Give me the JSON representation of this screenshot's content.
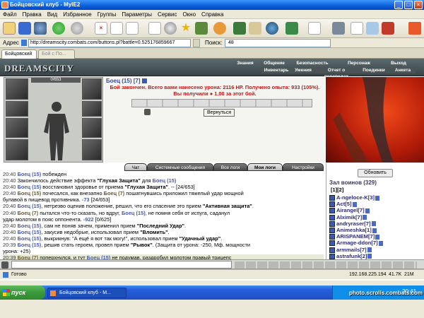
{
  "window": {
    "title": "Бойцовский клуб - MyIE2",
    "minimize": "_",
    "maximize": "□",
    "close": "×"
  },
  "menu": [
    "Файл",
    "Правка",
    "Вид",
    "Избранное",
    "Группы",
    "Параметры",
    "Сервис",
    "Окно",
    "Справка"
  ],
  "address": {
    "label": "Адрес",
    "url": "http://dreamscity.combats.com/buttons.pl?battle=0.525176859667",
    "search_label": "Поиск:",
    "search_value": "48"
  },
  "tabs": [
    "Бойцовский",
    "Бой с По..."
  ],
  "game": {
    "logo": "DREAMSCITY",
    "nav_top": [
      "Знания",
      "Общение",
      "Безопасность",
      "Персонаж",
      "Выход"
    ],
    "nav_bottom": [
      "Инвентарь",
      "Умения",
      "Отчет о переводах",
      "Поединки",
      "Анкета"
    ],
    "hp_readout": "0/653",
    "fighter": {
      "name": "Боец",
      "level": "(15)",
      "rank": "[7]"
    },
    "battle_result": "Бой закончен. Всего вами нанесено урона: 2116 HP. Получено опыта: 933 (105%). Вы получили",
    "battle_reward": "1.00 за этот бой.",
    "return_button": "Вернуться",
    "refresh_button": "Обновить",
    "hall_title": "Зал воинов (329)",
    "pages": [
      "[1]",
      "[2]"
    ]
  },
  "chat_tabs": [
    "Чат",
    "Системные сообщения",
    "Все логи",
    "Мои логи",
    "Настройки"
  ],
  "log": [
    {
      "time": "20:40",
      "parts": [
        {
          "c": "n",
          "t": "Боец (15)"
        },
        {
          "c": "",
          "t": " побежден"
        }
      ]
    },
    {
      "time": "20:40",
      "parts": [
        {
          "c": "",
          "t": "Закончилось действие эффекта "
        },
        {
          "c": "q",
          "t": "\"Глухая Защита\""
        },
        {
          "c": "",
          "t": " для "
        },
        {
          "c": "n",
          "t": "Боец (15)"
        }
      ]
    },
    {
      "time": "20:40",
      "parts": [
        {
          "c": "n",
          "t": "Боец (15)"
        },
        {
          "c": "",
          "t": " восстановил здоровье от приема "
        },
        {
          "c": "q",
          "t": "\"Глухая Защита\""
        },
        {
          "c": "",
          "t": ". -- [24/653]"
        }
      ]
    },
    {
      "time": "20:40",
      "parts": [
        {
          "c": "e",
          "t": "Боец (15)"
        },
        {
          "c": "",
          "t": " почесался, как внезапно "
        },
        {
          "c": "e",
          "t": "Боец (7)"
        },
        {
          "c": "",
          "t": " пошатнувшись приложил тяжелый удар мощной"
        }
      ]
    },
    {
      "time": "",
      "parts": [
        {
          "c": "",
          "t": "булавой в пищевод противника. "
        },
        {
          "c": "d",
          "t": "-73"
        },
        {
          "c": "",
          "t": " [24/653]"
        }
      ]
    },
    {
      "time": "20:40",
      "parts": [
        {
          "c": "n",
          "t": "Боец (15)"
        },
        {
          "c": "",
          "t": ", нетрезво оценив положение, решил, что его спасение это прием "
        },
        {
          "c": "q",
          "t": "\"Активная защита\""
        },
        {
          "c": "",
          "t": "."
        }
      ]
    },
    {
      "time": "20:40",
      "parts": [
        {
          "c": "e",
          "t": "Боец (7)"
        },
        {
          "c": "",
          "t": " пытался что-то сказать, но вдруг, "
        },
        {
          "c": "n",
          "t": "Боец (15)"
        },
        {
          "c": "",
          "t": ", не помня себя от испуга, саданул"
        }
      ]
    },
    {
      "time": "",
      "parts": [
        {
          "c": "",
          "t": "удар молотом в пояс оппонента. "
        },
        {
          "c": "d",
          "t": "-922"
        },
        {
          "c": "",
          "t": " [0/625]"
        }
      ]
    },
    {
      "time": "20:40",
      "parts": [
        {
          "c": "n",
          "t": "Боец (15)"
        },
        {
          "c": "",
          "t": ", сам не поняв зачем, применил прием "
        },
        {
          "c": "q",
          "t": "\"Последний Удар\""
        },
        {
          "c": "",
          "t": "."
        }
      ]
    },
    {
      "time": "20:40",
      "parts": [
        {
          "c": "n",
          "t": "Боец (15)"
        },
        {
          "c": "",
          "t": ", закусив недобрые, использовал прием "
        },
        {
          "c": "q",
          "t": "\"Вломить\""
        },
        {
          "c": "",
          "t": "."
        }
      ]
    },
    {
      "time": "20:40",
      "parts": [
        {
          "c": "n",
          "t": "Боец (15)"
        },
        {
          "c": "",
          "t": ", выкрикнув: \"А ещё я вот так могу!\", использовал прием "
        },
        {
          "c": "q",
          "t": "\"Удачный удар\""
        },
        {
          "c": "",
          "t": "."
        }
      ]
    },
    {
      "time": "20:39",
      "parts": [
        {
          "c": "n",
          "t": "Боец (15)"
        },
        {
          "c": "",
          "t": ", решив стать героем, провел прием "
        },
        {
          "c": "q",
          "t": "\"Рывок\""
        },
        {
          "c": "",
          "t": ". (Защита от урона: -250, Мф. мощности"
        }
      ]
    },
    {
      "time": "",
      "parts": [
        {
          "c": "",
          "t": "урона: +25)"
        }
      ]
    },
    {
      "time": "20:39",
      "parts": [
        {
          "c": "e",
          "t": "Боец (7)"
        },
        {
          "c": "",
          "t": " поперхнулся, и тут "
        },
        {
          "c": "n",
          "t": "Боец (15)"
        },
        {
          "c": "",
          "t": " не подумав, раздробил молотом правый трицепс"
        }
      ]
    },
    {
      "time": "",
      "parts": [
        {
          "c": "",
          "t": "врага. "
        },
        {
          "c": "d",
          "t": "-104"
        },
        {
          "c": "",
          "t": " [44/625]"
        }
      ]
    }
  ],
  "players": [
    "A-ngeloce-K[3]",
    "Act[5]",
    "Airangel[7]",
    "Alximik[7]",
    "andryraser[7]",
    "Animeshka[1]",
    "ARISPANEM[7]",
    "Armage-ddon[7]",
    "armmails[7]",
    "astrafunk[2]",
    "AWA[7]"
  ],
  "status": {
    "ready": "Готово",
    "ip": "192.168.225.194",
    "speed": "41.7K",
    "kb": "21M"
  },
  "taskbar": {
    "start": "пуск",
    "window": "Бойцовский клуб - М...",
    "clock": "20:41"
  },
  "watermark": "photo.scrolls.combats.com",
  "colors": {
    "accent": "#0A5FD8",
    "game_header": "#4a5356",
    "damage": "#4a5aaa"
  }
}
